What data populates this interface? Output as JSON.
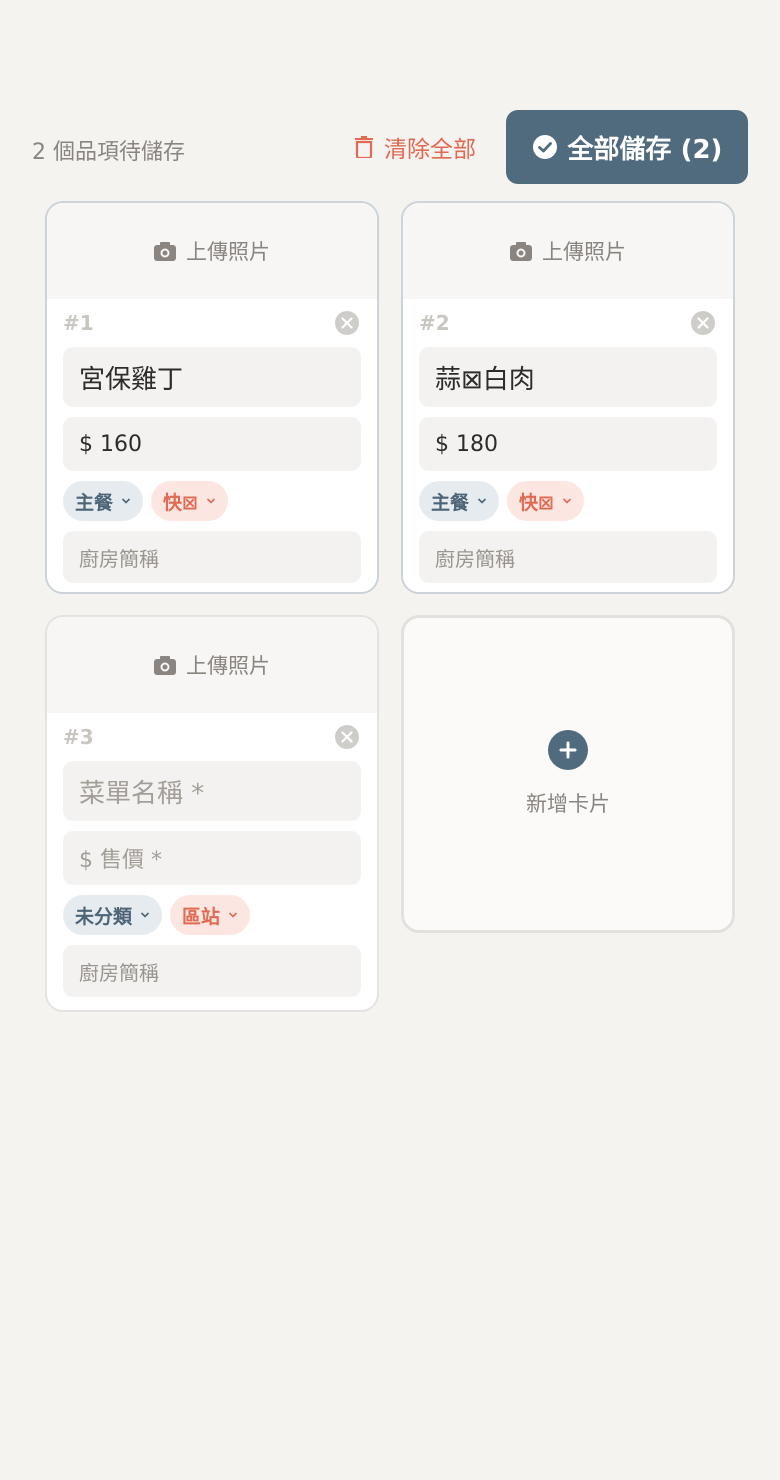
{
  "toolbar": {
    "pending_text": "2 個品項待儲存",
    "clear_label": "清除全部",
    "save_label": "全部儲存 (2)"
  },
  "cards": [
    {
      "upload_label": "上傳照片",
      "number": "#1",
      "name": "宮保雞丁",
      "price": "$ 160",
      "category": "主餐",
      "station": "快⊠",
      "short_name_placeholder": "廚房簡稱"
    },
    {
      "upload_label": "上傳照片",
      "number": "#2",
      "name": "蒜⊠白肉",
      "price": "$ 180",
      "category": "主餐",
      "station": "快⊠",
      "short_name_placeholder": "廚房簡稱"
    },
    {
      "upload_label": "上傳照片",
      "number": "#3",
      "name_placeholder": "菜單名稱 *",
      "price_placeholder": "$ 售價 *",
      "category": "未分類",
      "station": "區站",
      "short_name_placeholder": "廚房簡稱"
    }
  ],
  "add_card": {
    "label": "新增卡片"
  },
  "colors": {
    "accent": "#506b7e",
    "danger": "#e06a52",
    "background": "#f4f3f0"
  }
}
